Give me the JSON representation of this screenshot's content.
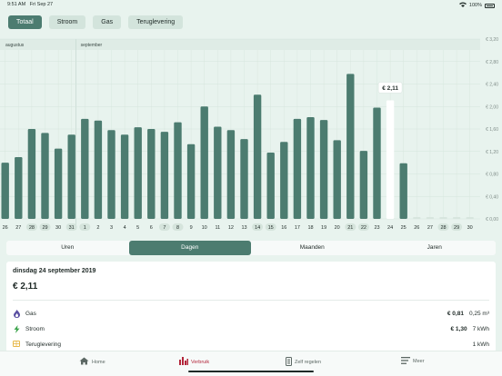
{
  "status": {
    "time": "9:51 AM",
    "date": "Fri Sep 27",
    "battery": "100%"
  },
  "segments": [
    {
      "label": "Totaal",
      "active": true
    },
    {
      "label": "Stroom",
      "active": false
    },
    {
      "label": "Gas",
      "active": false
    },
    {
      "label": "Teruglevering",
      "active": false
    }
  ],
  "chart_data": {
    "type": "bar",
    "month_labels": [
      "augustus",
      "september"
    ],
    "categories": [
      "26",
      "27",
      "28",
      "29",
      "30",
      "31",
      "1",
      "2",
      "3",
      "4",
      "5",
      "6",
      "7",
      "8",
      "9",
      "10",
      "11",
      "12",
      "13",
      "14",
      "15",
      "16",
      "17",
      "18",
      "19",
      "20",
      "21",
      "22",
      "23",
      "24",
      "25",
      "26",
      "27",
      "28",
      "29",
      "30"
    ],
    "weekend_days": [
      "31",
      "1",
      "7",
      "8",
      "14",
      "15",
      "21",
      "22",
      "28",
      "29"
    ],
    "values": [
      1.0,
      1.1,
      1.6,
      1.53,
      1.25,
      1.5,
      1.78,
      1.75,
      1.58,
      1.5,
      1.63,
      1.6,
      1.55,
      1.72,
      1.33,
      2.0,
      1.64,
      1.58,
      1.42,
      2.21,
      1.18,
      1.37,
      1.78,
      1.81,
      1.76,
      1.4,
      2.58,
      1.21,
      1.98,
      2.11,
      0.99,
      0,
      0,
      0,
      0,
      0
    ],
    "selected_index": 29,
    "selected_label": "€ 2,11",
    "yticks": [
      "€ 0,00",
      "€ 0,40",
      "€ 0,80",
      "€ 1,20",
      "€ 1,60",
      "€ 2,00",
      "€ 2,40",
      "€ 2,80",
      "€ 3,20"
    ],
    "ylim": [
      0,
      3.2
    ],
    "colors": {
      "bar": "#4c7c70",
      "selected": "#ffffff",
      "grid": "#d5e4dc"
    }
  },
  "period_tabs": [
    {
      "label": "Uren",
      "active": false
    },
    {
      "label": "Dagen",
      "active": true
    },
    {
      "label": "Maanden",
      "active": false
    },
    {
      "label": "Jaren",
      "active": false
    }
  ],
  "detail": {
    "date": "dinsdag 24 september 2019",
    "total": "€ 2,11",
    "rows": [
      {
        "icon": "flame-icon",
        "label": "Gas",
        "value": "€ 0,81",
        "unit": "0,25 m³",
        "color": "#5a4fa2"
      },
      {
        "icon": "lightning-icon",
        "label": "Stroom",
        "value": "€ 1,30",
        "unit": "7 kWh",
        "color": "#3ca44c"
      },
      {
        "icon": "solar-panel-icon",
        "label": "Teruglevering",
        "value": "",
        "unit": "1 kWh",
        "color": "#e7b84a"
      }
    ]
  },
  "tabbar": [
    {
      "label": "Home",
      "icon": "home-icon",
      "active": false
    },
    {
      "label": "Verbruik",
      "icon": "bar-chart-icon",
      "active": true
    },
    {
      "label": "Zelf regelen",
      "icon": "device-icon",
      "active": false
    },
    {
      "label": "Meer",
      "icon": "menu-icon",
      "active": false
    }
  ]
}
